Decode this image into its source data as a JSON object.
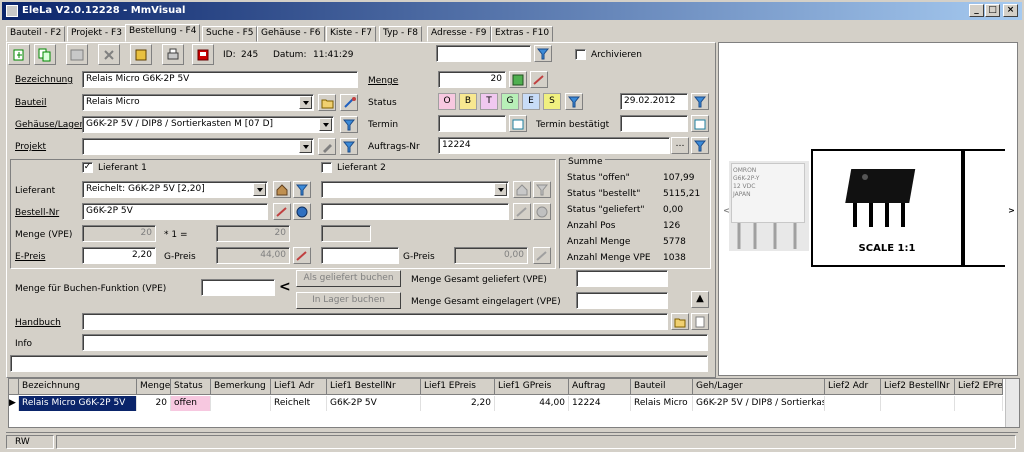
{
  "window": {
    "title": "EleLa V2.0.12228 - MmVisual"
  },
  "tabs": [
    "Bauteil - F2",
    "Projekt - F3",
    "Bestellung - F4",
    "Suche - F5",
    "Gehäuse - F6",
    "Kiste - F7",
    "Typ - F8",
    "Adresse - F9",
    "Extras - F10"
  ],
  "header": {
    "id_label": "ID:",
    "id_value": "245",
    "datum_label": "Datum:",
    "datum_value": "11:41:29",
    "archivieren": "Archivieren"
  },
  "form": {
    "bezeichnung_label": "Bezeichnung",
    "bezeichnung": "Relais Micro G6K-2P 5V",
    "bauteil_label": "Bauteil",
    "bauteil": "Relais Micro",
    "gehaeuse_label": "Gehäuse/Lager",
    "gehaeuse": "G6K-2P 5V / DIP8 / Sortierkasten M [07 D]",
    "projekt_label": "Projekt",
    "projekt": "",
    "menge_label": "Menge",
    "menge": "20",
    "status_label": "Status",
    "status_letters": [
      "O",
      "B",
      "T",
      "G",
      "E",
      "S"
    ],
    "status_date": "29.02.2012",
    "termin_label": "Termin",
    "termin_bestaetigt_label": "Termin bestätigt",
    "auftrags_label": "Auftrags-Nr",
    "auftrags": "12224",
    "lieferant1_label": "Lieferant 1",
    "lieferant2_label": "Lieferant 2",
    "lieferant_label": "Lieferant",
    "lieferant": "Reichelt: G6K-2P 5V [2,20]",
    "bestellnr_label": "Bestell-Nr",
    "bestellnr": "G6K-2P 5V",
    "menge_vpe_label": "Menge (VPE)",
    "menge_vpe": "20",
    "mult": "* 1 =",
    "menge_res": "20",
    "epreis_label": "E-Preis",
    "epreis": "2,20",
    "gpreis_label": "G-Preis",
    "gpreis": "44,00",
    "gpreis2_label": "G-Preis",
    "gpreis2": "0,00",
    "buchen_label": "Menge für Buchen-Funktion (VPE)",
    "lt": "<",
    "btn_geliefert": "Als geliefert buchen",
    "btn_lager": "In Lager buchen",
    "gesamt_geliefert": "Menge Gesamt geliefert (VPE)",
    "gesamt_eingelagert": "Menge Gesamt eingelagert (VPE)",
    "handbuch_label": "Handbuch",
    "info_label": "Info"
  },
  "summe": {
    "title": "Summe",
    "rows": [
      [
        "Status \"offen\"",
        "107,99"
      ],
      [
        "Status \"bestellt\"",
        "5115,21"
      ],
      [
        "Status \"geliefert\"",
        "0,00"
      ],
      [
        "Anzahl Pos",
        "126"
      ],
      [
        "Anzahl Menge",
        "5778"
      ],
      [
        "Anzahl Menge VPE",
        "1038"
      ]
    ]
  },
  "image": {
    "part_text": [
      "OMRON",
      "G6K-2P-Y",
      "12 VDC",
      "JAPAN"
    ],
    "scale": "SCALE 1:1"
  },
  "grid": {
    "headers": [
      "Bezeichnung",
      "Menge",
      "Status",
      "Bemerkung",
      "Lief1 Adr",
      "Lief1 BestellNr",
      "Lief1 EPreis",
      "Lief1 GPreis",
      "Auftrag",
      "Bauteil",
      "Geh/Lager",
      "Lief2 Adr",
      "Lief2 BestellNr",
      "Lief2 EPre"
    ],
    "row": [
      "Relais Micro G6K-2P 5V",
      "20",
      "offen",
      "",
      "Reichelt",
      "G6K-2P 5V",
      "2,20",
      "44,00",
      "12224",
      "Relais Micro",
      "G6K-2P 5V / DIP8 / Sortierkas",
      "",
      "",
      ""
    ]
  },
  "statusbar": {
    "mode": "RW"
  },
  "colors": {
    "status_o": "#f7c8e0",
    "status_b": "#f8e890",
    "status_t": "#f0c8f0",
    "status_g": "#b8f0b8",
    "status_e": "#c8dcf8",
    "status_s": "#f0f080"
  }
}
